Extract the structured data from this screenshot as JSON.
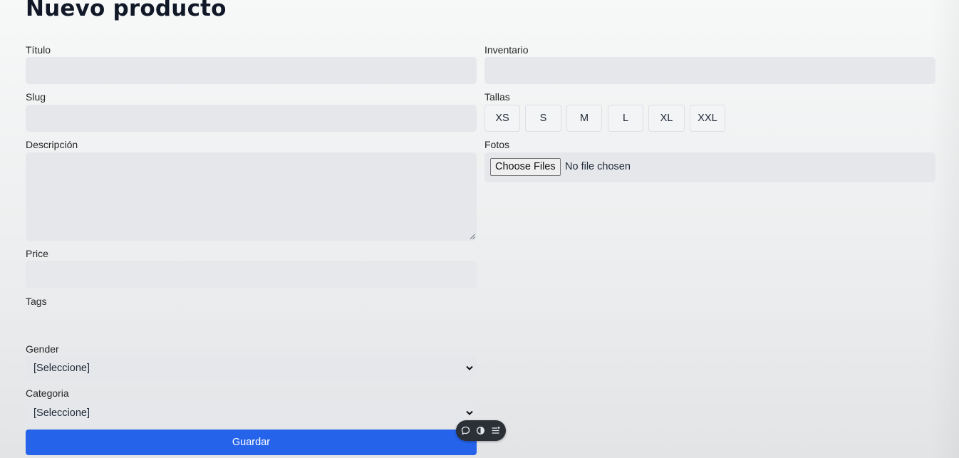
{
  "page": {
    "title": "Nuevo producto"
  },
  "form": {
    "titulo": {
      "label": "Título",
      "value": ""
    },
    "slug": {
      "label": "Slug",
      "value": ""
    },
    "descripcion": {
      "label": "Descripción",
      "value": ""
    },
    "price": {
      "label": "Price",
      "value": ""
    },
    "tags": {
      "label": "Tags",
      "value": ""
    },
    "gender": {
      "label": "Gender",
      "selected": "[Seleccione]"
    },
    "categoria": {
      "label": "Categoria",
      "selected": "[Seleccione]"
    },
    "inventario": {
      "label": "Inventario",
      "value": ""
    },
    "tallas": {
      "label": "Tallas",
      "options": [
        "XS",
        "S",
        "M",
        "L",
        "XL",
        "XXL"
      ]
    },
    "fotos": {
      "label": "Fotos",
      "button_label": "Choose Files",
      "status": "No file chosen"
    },
    "submit_label": "Guardar"
  },
  "toolbar": {
    "icons": [
      "chat-bubble-icon",
      "toggle-icon",
      "menu-list-icon"
    ]
  },
  "colors": {
    "primary": "#2563eb",
    "field_bg": "#e5e7eb",
    "toolbar_bg": "#2b2f36"
  }
}
